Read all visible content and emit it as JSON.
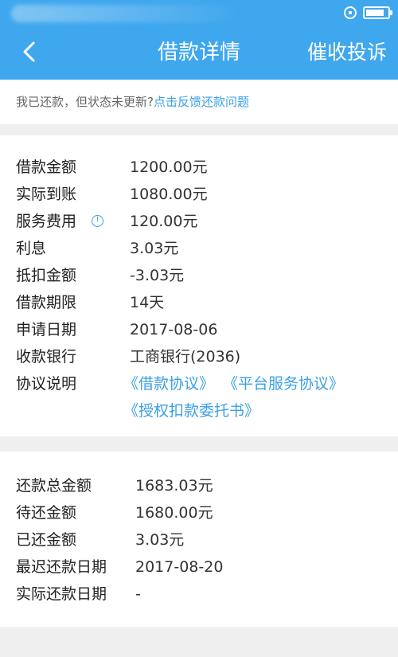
{
  "header": {
    "title": "借款详情",
    "action_label": "催收投诉"
  },
  "notice": {
    "text": "我已还款，但状态未更新?",
    "link": "点击反馈还款问题"
  },
  "loan_details": {
    "rows": [
      {
        "label": "借款金额",
        "value": "1200.00元"
      },
      {
        "label": "实际到账",
        "value": "1080.00元"
      },
      {
        "label": "服务费用",
        "value": "120.00元",
        "info_icon": "info-icon"
      },
      {
        "label": "利息",
        "value": "3.03元"
      },
      {
        "label": "抵扣金额",
        "value": "-3.03元"
      },
      {
        "label": "借款期限",
        "value": "14天"
      },
      {
        "label": "申请日期",
        "value": "2017-08-06"
      },
      {
        "label": "收款银行",
        "value": "工商银行(2036)"
      }
    ],
    "protocol_label": "协议说明",
    "protocols": [
      "《借款协议》",
      "《平台服务协议》",
      "《授权扣款委托书》"
    ]
  },
  "repayment": {
    "rows": [
      {
        "label": "还款总金额",
        "value": "1683.03元"
      },
      {
        "label": "待还金额",
        "value": "1680.00元"
      },
      {
        "label": "已还金额",
        "value": "3.03元"
      },
      {
        "label": "最迟还款日期",
        "value": "2017-08-20"
      },
      {
        "label": "实际还款日期",
        "value": "-"
      }
    ]
  },
  "colors": {
    "header_bg": "#3fa7ee",
    "link": "#3aa0e6",
    "page_bg": "#efefef"
  }
}
